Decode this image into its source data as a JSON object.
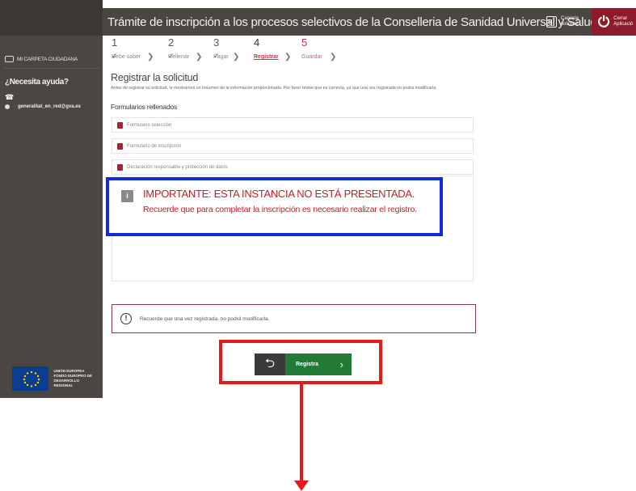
{
  "header": {
    "title": "Trámite de inscripción a los procesos selectivos de la Conselleria de Sanidad Universal y Salud Pública",
    "cancel_label_1": "Cancela",
    "cancel_label_2": "solicitud",
    "close_label_1": "Cerrar",
    "close_label_2": "Aplicació"
  },
  "sidebar": {
    "folder_label": "MI CARPETA CIUDADANA",
    "help_title": "¿Necesita ayuda?",
    "phone": "☎",
    "email": "generalitat_en_red@gva.es",
    "eu_text_1": "UNIÓN EUROPEA",
    "eu_text_2": "FONDO EUROPEO DE",
    "eu_text_3": "DESARROLLO REGIONAL"
  },
  "steps": [
    {
      "num": "1",
      "label": "Debe saber",
      "state": "done"
    },
    {
      "num": "2",
      "label": "Rellenar",
      "state": "done"
    },
    {
      "num": "3",
      "label": "Pagar",
      "state": "done"
    },
    {
      "num": "4",
      "label": "Registrar",
      "state": "current"
    },
    {
      "num": "5",
      "label": "Guardar",
      "state": "next"
    }
  ],
  "main": {
    "title": "Registrar la solicitud",
    "intro": "Antes de registrar su solicitud, le mostramos un resumen de la información proporcionada. Por favor revise que es correcta, ya que una vez registrada no podrá modificarla.",
    "forms_title": "Formularios rellenados",
    "forms": [
      "Formulario selección",
      "Formulario de inscripción",
      "Declaración responsable y protección de datos"
    ],
    "important_title": "IMPORTANTE: ESTA INSTANCIA NO ESTÁ PRESENTADA.",
    "important_text": "Recuerde que para completar la inscripción es necesario realizar el registro.",
    "warning": "Recuerde que una vez registrada, no podrá modificarla.",
    "register_label": "Registra"
  },
  "colors": {
    "annotation_blue": "#1428e0",
    "annotation_red": "#e01b1b",
    "brand_red": "#8c1b2b",
    "register_green": "#237a37"
  }
}
